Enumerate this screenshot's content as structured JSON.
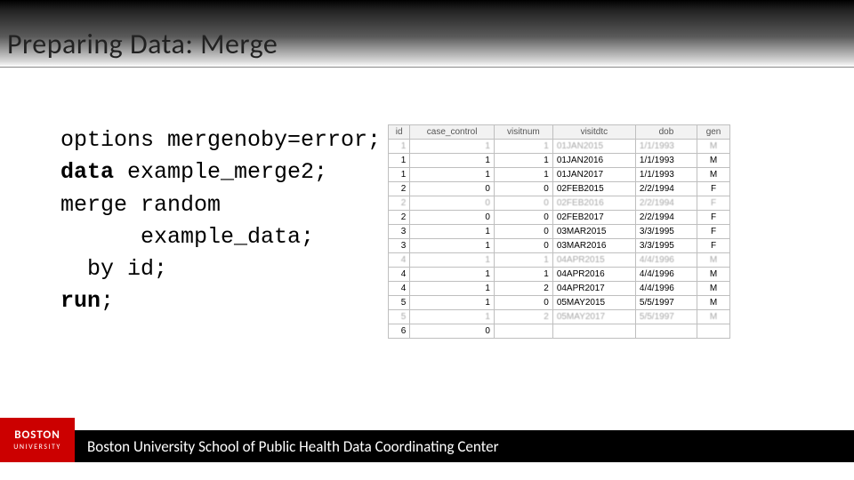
{
  "title": "Preparing Data: Merge",
  "code": {
    "l1a": "options mergenoby=error;",
    "l2a": "data",
    "l2b": " example_merge2;",
    "l3a": "merge random",
    "l4a": "      example_data;",
    "l5a": "  by id;",
    "l6a": "run",
    "l6b": ";"
  },
  "table": {
    "headers": [
      "id",
      "case_control",
      "visitnum",
      "visitdtc",
      "dob",
      "gen"
    ],
    "rows": [
      [
        "1",
        "1",
        "1",
        "01JAN2015",
        "1/1/1993",
        "M"
      ],
      [
        "1",
        "1",
        "1",
        "01JAN2016",
        "1/1/1993",
        "M"
      ],
      [
        "1",
        "1",
        "1",
        "01JAN2017",
        "1/1/1993",
        "M"
      ],
      [
        "2",
        "0",
        "0",
        "02FEB2015",
        "2/2/1994",
        "F"
      ],
      [
        "2",
        "0",
        "0",
        "02FEB2016",
        "2/2/1994",
        "F"
      ],
      [
        "2",
        "0",
        "0",
        "02FEB2017",
        "2/2/1994",
        "F"
      ],
      [
        "3",
        "1",
        "0",
        "03MAR2015",
        "3/3/1995",
        "F"
      ],
      [
        "3",
        "1",
        "0",
        "03MAR2016",
        "3/3/1995",
        "F"
      ],
      [
        "4",
        "1",
        "1",
        "04APR2015",
        "4/4/1996",
        "M"
      ],
      [
        "4",
        "1",
        "1",
        "04APR2016",
        "4/4/1996",
        "M"
      ],
      [
        "4",
        "1",
        "2",
        "04APR2017",
        "4/4/1996",
        "M"
      ],
      [
        "5",
        "1",
        "0",
        "05MAY2015",
        "5/5/1997",
        "M"
      ],
      [
        "5",
        "1",
        "2",
        "05MAY2017",
        "5/5/1997",
        "M"
      ],
      [
        "6",
        "0",
        "",
        "",
        "",
        ""
      ]
    ]
  },
  "footer": {
    "logo1": "BOSTON",
    "logo2": "UNIVERSITY",
    "text": "Boston University School of Public Health Data Coordinating Center"
  }
}
